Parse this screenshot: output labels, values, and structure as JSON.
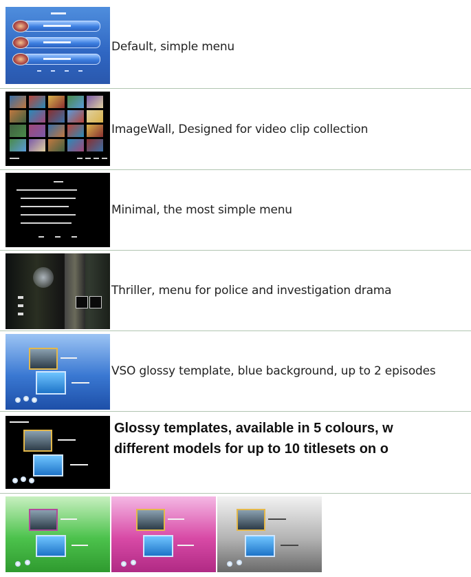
{
  "templates": [
    {
      "name": "Default",
      "description": "Default, simple menu"
    },
    {
      "name": "ImageWall",
      "description": "ImageWall, Designed for video clip collection"
    },
    {
      "name": "Minimal",
      "description": "Minimal, the most simple menu"
    },
    {
      "name": "Thriller",
      "description": "Thriller, menu for police and investigation drama"
    },
    {
      "name": "VSO glossy",
      "description": "VSO glossy template, blue background, up to 2 episodes"
    }
  ],
  "glossy_note": {
    "line1": "Glossy templates, available in 5 colours, w",
    "line2": "different models for up to 10 titlesets on o"
  },
  "colors": {
    "frame_gold": "#e4b84a",
    "green": "#3bb43b",
    "pink": "#d0409a",
    "grey": "#9a9a9a",
    "blue": "#2f66c2"
  }
}
